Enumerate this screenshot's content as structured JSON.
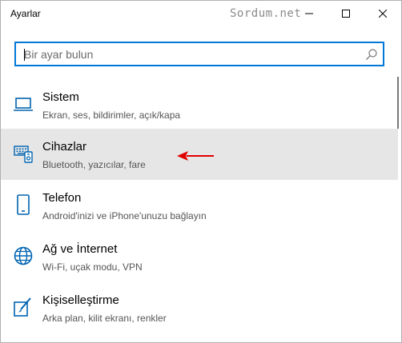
{
  "window": {
    "title": "Ayarlar",
    "watermark": "Sordum.net"
  },
  "search": {
    "placeholder": "Bir ayar bulun",
    "value": ""
  },
  "items": [
    {
      "name": "Sistem",
      "desc": "Ekran, ses, bildirimler, açık/kapa",
      "icon": "laptop-icon",
      "selected": false
    },
    {
      "name": "Cihazlar",
      "desc": "Bluetooth, yazıcılar, fare",
      "icon": "devices-icon",
      "selected": true
    },
    {
      "name": "Telefon",
      "desc": "Android'inizi ve iPhone'unuzu bağlayın",
      "icon": "phone-icon",
      "selected": false
    },
    {
      "name": "Ağ ve İnternet",
      "desc": "Wi-Fi, uçak modu, VPN",
      "icon": "globe-icon",
      "selected": false
    },
    {
      "name": "Kişiselleştirme",
      "desc": "Arka plan, kilit ekranı, renkler",
      "icon": "personalization-icon",
      "selected": false
    }
  ],
  "colors": {
    "accent": "#0078d7",
    "selected_bg": "#e6e6e6",
    "arrow": "#e00000"
  }
}
